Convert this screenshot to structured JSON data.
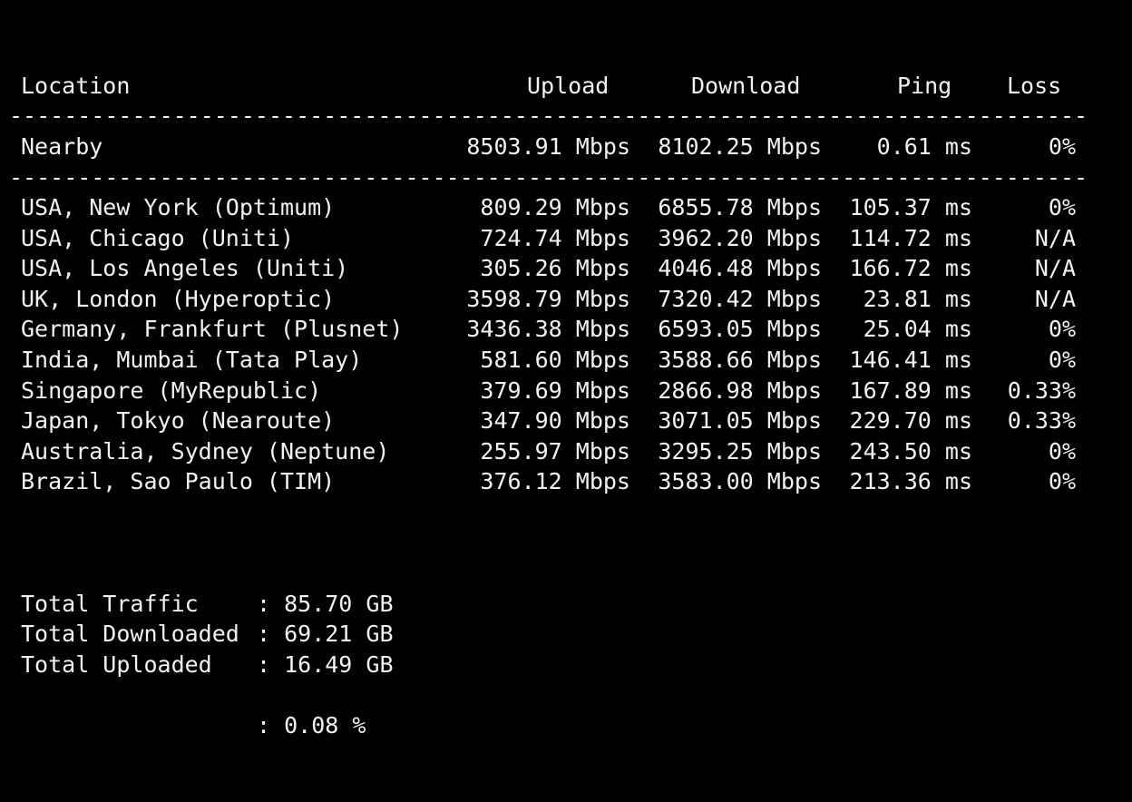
{
  "header": {
    "location": "Location",
    "upload": "Upload",
    "download": "Download",
    "ping": "Ping",
    "loss": "Loss"
  },
  "separator": "----------------------------------------------------------------------------------------------------",
  "nearby": {
    "location": "Nearby",
    "upload": "8503.91 Mbps",
    "download": "8102.25 Mbps",
    "ping": "0.61 ms",
    "loss": "0%"
  },
  "rows": [
    {
      "location": "USA, New York (Optimum)",
      "upload": "809.29 Mbps",
      "download": "6855.78 Mbps",
      "ping": "105.37 ms",
      "loss": "0%"
    },
    {
      "location": "USA, Chicago (Uniti)",
      "upload": "724.74 Mbps",
      "download": "3962.20 Mbps",
      "ping": "114.72 ms",
      "loss": "N/A"
    },
    {
      "location": "USA, Los Angeles (Uniti)",
      "upload": "305.26 Mbps",
      "download": "4046.48 Mbps",
      "ping": "166.72 ms",
      "loss": "N/A"
    },
    {
      "location": "UK, London (Hyperoptic)",
      "upload": "3598.79 Mbps",
      "download": "7320.42 Mbps",
      "ping": "23.81 ms",
      "loss": "N/A"
    },
    {
      "location": "Germany, Frankfurt (Plusnet)",
      "upload": "3436.38 Mbps",
      "download": "6593.05 Mbps",
      "ping": "25.04 ms",
      "loss": "0%"
    },
    {
      "location": "India, Mumbai (Tata Play)",
      "upload": "581.60 Mbps",
      "download": "3588.66 Mbps",
      "ping": "146.41 ms",
      "loss": "0%"
    },
    {
      "location": "Singapore (MyRepublic)",
      "upload": "379.69 Mbps",
      "download": "2866.98 Mbps",
      "ping": "167.89 ms",
      "loss": "0.33%"
    },
    {
      "location": "Japan, Tokyo (Nearoute)",
      "upload": "347.90 Mbps",
      "download": "3071.05 Mbps",
      "ping": "229.70 ms",
      "loss": "0.33%"
    },
    {
      "location": "Australia, Sydney (Neptune)",
      "upload": "255.97 Mbps",
      "download": "3295.25 Mbps",
      "ping": "243.50 ms",
      "loss": "0%"
    },
    {
      "location": "Brazil, Sao Paulo (TIM)",
      "upload": "376.12 Mbps",
      "download": "3583.00 Mbps",
      "ping": "213.36 ms",
      "loss": "0%"
    }
  ],
  "summary": {
    "total_traffic_label": "Total Traffic",
    "total_traffic_value": ": 85.70 GB",
    "total_downloaded_label": "Total Downloaded",
    "total_downloaded_value": ": 69.21 GB",
    "total_uploaded_label": "Total Uploaded",
    "total_uploaded_value": ": 16.49 GB",
    "extra_value": ": 0.08 %"
  }
}
